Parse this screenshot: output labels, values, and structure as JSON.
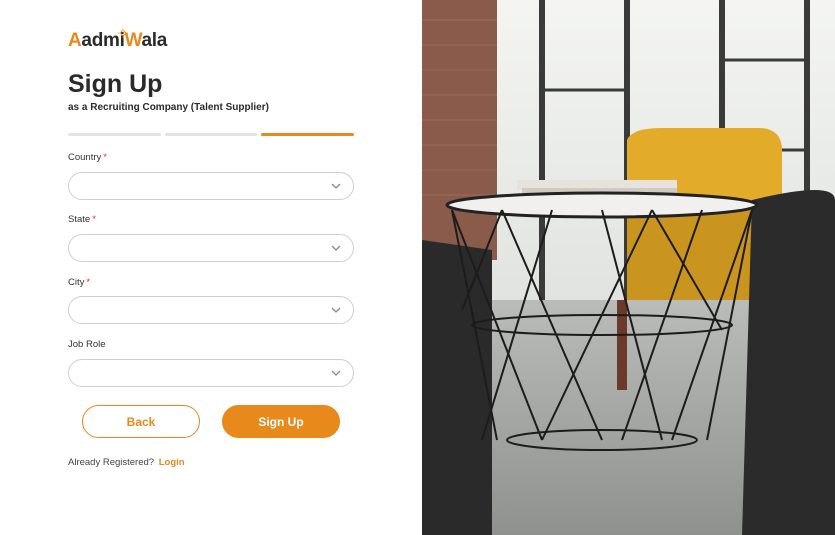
{
  "brand": {
    "logo_text_start": "A",
    "logo_text_mid": "admi",
    "logo_text_w": "W",
    "logo_text_end": "ala",
    "accent": "#e8891c"
  },
  "header": {
    "title": "Sign Up",
    "subtitle": "as a Recruiting Company (Talent Supplier)"
  },
  "progress": {
    "total_steps": 3,
    "active_step": 3
  },
  "form": {
    "country": {
      "label": "Country",
      "required": "*",
      "value": ""
    },
    "state": {
      "label": "State",
      "required": "*",
      "value": ""
    },
    "city": {
      "label": "City",
      "required": "*",
      "value": ""
    },
    "job_role": {
      "label": "Job Role",
      "value": ""
    }
  },
  "actions": {
    "back_label": "Back",
    "signup_label": "Sign Up"
  },
  "footer": {
    "prompt": "Already Registered?",
    "login_label": "Login"
  },
  "icons": {
    "dropdown": "chevron-down-icon"
  },
  "colors": {
    "accent": "#e8891c",
    "border": "#cfcfcf",
    "required": "#d83030"
  }
}
